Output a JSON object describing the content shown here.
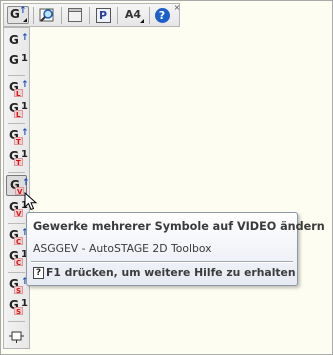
{
  "toolbar": {
    "buttons": [
      {
        "name": "g-dropdown-button",
        "glyph": "G",
        "icon": "g-arrow-icon"
      },
      {
        "name": "zoom-button",
        "icon": "magnifier-icon"
      },
      {
        "name": "window-button",
        "icon": "window-icon"
      },
      {
        "name": "p-button",
        "glyph": "P",
        "icon": "p-icon"
      },
      {
        "name": "page-size-button",
        "glyph": "A4",
        "icon": "a4-icon"
      },
      {
        "name": "help-button",
        "glyph": "?",
        "icon": "help-icon"
      }
    ],
    "close_glyph": "×"
  },
  "palette": {
    "items": [
      {
        "main": "G",
        "suffix": "↑",
        "sub": ""
      },
      {
        "main": "G",
        "suffix": "1",
        "sub": ""
      },
      {
        "main": "G",
        "suffix": "↑",
        "sub": "L"
      },
      {
        "main": "G",
        "suffix": "1",
        "sub": "L"
      },
      {
        "main": "G",
        "suffix": "↑",
        "sub": "T"
      },
      {
        "main": "G",
        "suffix": "1",
        "sub": "T"
      },
      {
        "main": "G",
        "suffix": "↑",
        "sub": "V"
      },
      {
        "main": "G",
        "suffix": "1",
        "sub": "V"
      },
      {
        "main": "G",
        "suffix": "↑",
        "sub": "C"
      },
      {
        "main": "G",
        "suffix": "1",
        "sub": "C"
      },
      {
        "main": "G",
        "suffix": "↑",
        "sub": "S"
      },
      {
        "main": "G",
        "suffix": "1",
        "sub": "S"
      }
    ],
    "active_index": 6
  },
  "tooltip": {
    "title": "Gewerke mehrerer Symbole auf VIDEO ändern",
    "description": "ASGGEV - AutoSTAGE 2D Toolbox",
    "help_icon": "?",
    "help_text": "F1 drücken, um weitere Hilfe zu erhalten"
  },
  "colors": {
    "background": "#fdfdf0",
    "arrow_blue": "#1a4fb8",
    "sub_red": "#d11111"
  }
}
